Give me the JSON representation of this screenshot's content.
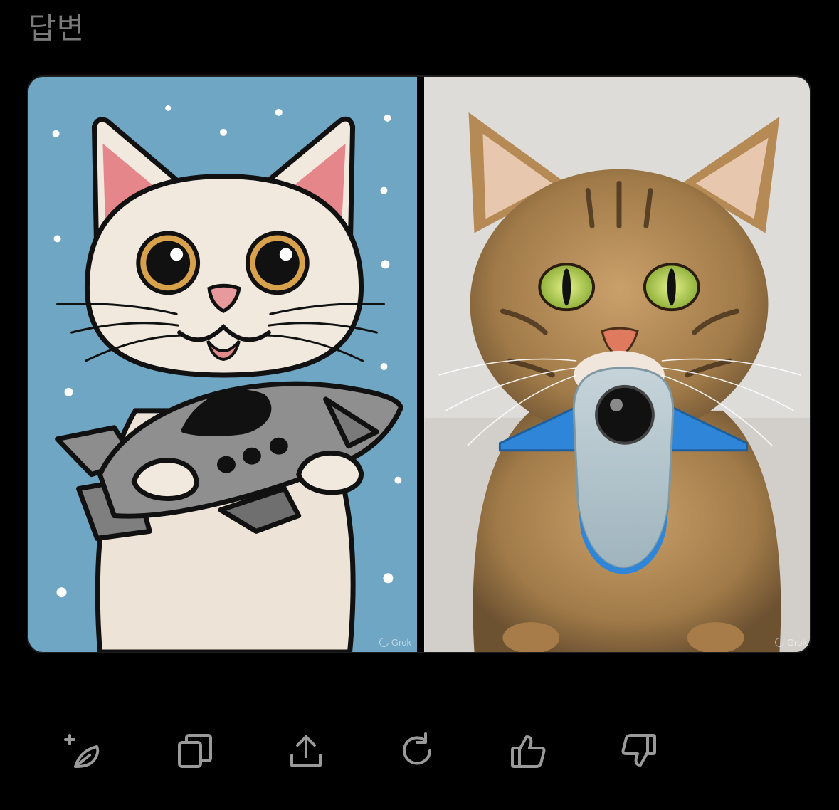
{
  "header": {
    "title": "답변"
  },
  "images": [
    {
      "watermark": "Grok"
    },
    {
      "watermark": "Grok"
    }
  ],
  "toolbar": {
    "icons": [
      "edit-icon",
      "copy-icon",
      "share-icon",
      "regenerate-icon",
      "thumbs-up-icon",
      "thumbs-down-icon"
    ],
    "icon_color": "#9a9a9a"
  },
  "colors": {
    "background": "#000000",
    "title": "#7a7a7a"
  }
}
